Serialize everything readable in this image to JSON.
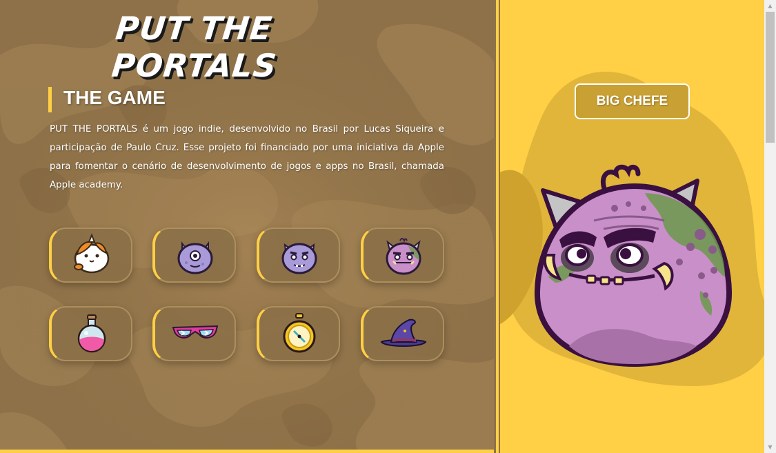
{
  "header": {
    "title": "PUT THE PORTALS"
  },
  "about": {
    "heading": "THE GAME",
    "description": "PUT THE PORTALS é um jogo indie, desenvolvido no Brasil por Lucas Siqueira e participação de Paulo Cruz. Esse projeto foi financiado por uma iniciativa da Apple para fomentar o cenário de desenvolvimento de jogos e apps no Brasil, chamada Apple academy."
  },
  "items": [
    {
      "icon": "hamster-icon"
    },
    {
      "icon": "cyclops-monster-icon"
    },
    {
      "icon": "purple-monster-icon"
    },
    {
      "icon": "big-chefe-monster-icon"
    },
    {
      "icon": "pink-potion-icon"
    },
    {
      "icon": "sunglasses-icon"
    },
    {
      "icon": "stopwatch-icon"
    },
    {
      "icon": "witch-hat-icon"
    }
  ],
  "featured": {
    "name": "BIG CHEFE",
    "icon": "big-chefe-monster-icon"
  },
  "colors": {
    "accent": "#ffcf45",
    "panel": "#8f7249",
    "monster": "#c98fc9"
  },
  "scrollbar": {
    "up": "▲",
    "down": "▼"
  }
}
